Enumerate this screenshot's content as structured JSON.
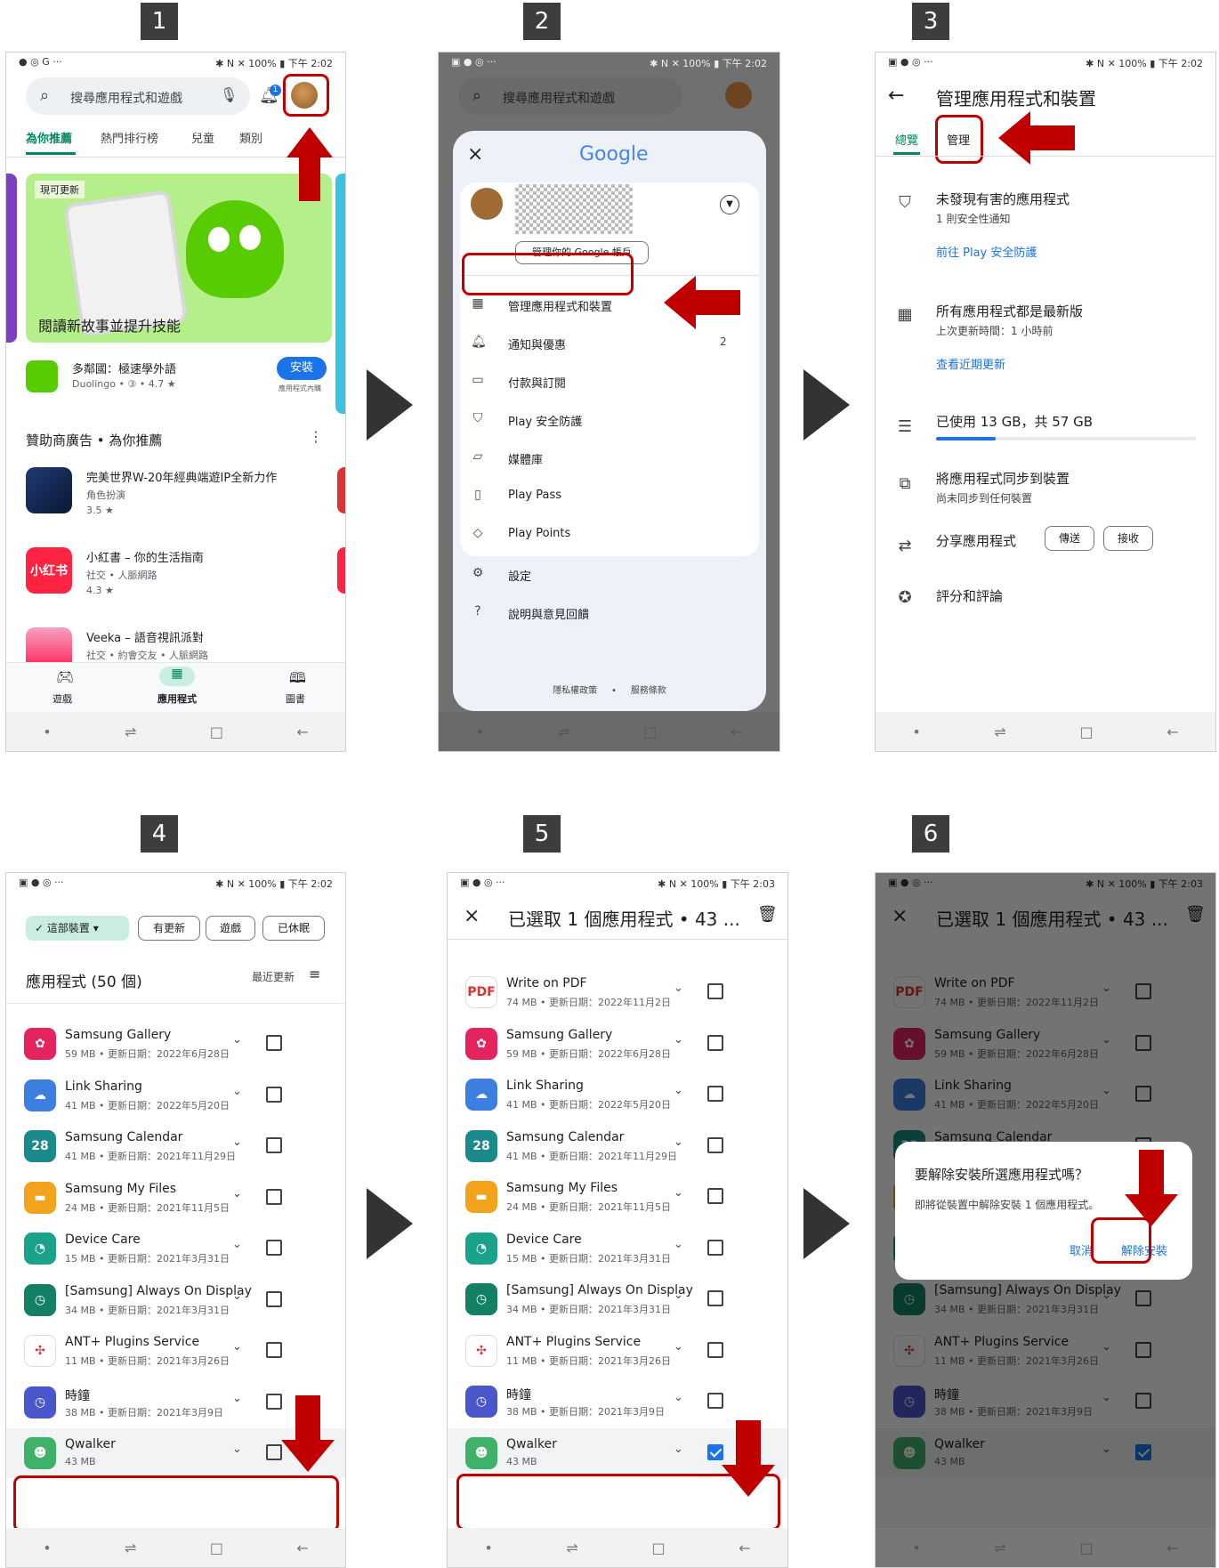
{
  "steps": [
    "1",
    "2",
    "3",
    "4",
    "5",
    "6"
  ],
  "status": {
    "left1": "● ◎ G ···",
    "left": "▣ ● ◎ ···",
    "right1": "✱ N ✕ 100% ▮ 下午 2:02",
    "right2": "✱ N ✕ 100% ▮ 下午 2:03"
  },
  "s1": {
    "search_placeholder": "搜尋應用程式和遊戲",
    "notif_count": "1",
    "tabs": [
      "為你推薦",
      "熱門排行榜",
      "兒童",
      "類別"
    ],
    "banner_tag": "現可更新",
    "banner_title": "閱讀新故事並提升技能",
    "feat_app": "多鄰國：極速學外語",
    "feat_meta": "Duolingo • ③ • 4.7 ★",
    "install": "安裝",
    "install_sub": "應用程式內購",
    "section": "贊助商廣告 • 為你推薦",
    "apps": [
      {
        "name": "完美世界W-20年經典端遊IP全新力作",
        "cat": "角色扮演",
        "rating": "3.5 ★"
      },
      {
        "name": "小紅書 – 你的生活指南",
        "cat": "社交 • 人脈網路",
        "rating": "4.3 ★"
      },
      {
        "name": "Veeka – 語音視訊派對",
        "cat": "社交 • 約會交友 • 人脈網路",
        "rating": ""
      }
    ],
    "xhs_logo": "小红书",
    "bottom": [
      "遊戲",
      "應用程式",
      "圖書"
    ]
  },
  "s2": {
    "search_placeholder": "搜尋應用程式和遊戲",
    "google": "Google",
    "manage_account": "管理你的 Google 帳戶",
    "items": [
      "管理應用程式和裝置",
      "通知與優惠",
      "付款與訂閱",
      "Play 安全防護",
      "媒體庫",
      "Play Pass",
      "Play Points",
      "設定",
      "說明與意見回饋"
    ],
    "notif_count": "2",
    "footer_privacy": "隱私權政策",
    "footer_dot": "•",
    "footer_terms": "服務條款"
  },
  "s3": {
    "title": "管理應用程式和裝置",
    "tab_overview": "總覽",
    "tab_manage": "管理",
    "rows": [
      {
        "title": "未發現有害的應用程式",
        "sub": "1 則安全性通知",
        "link": "前往 Play 安全防護"
      },
      {
        "title": "所有應用程式都是最新版",
        "sub": "上次更新時間：1 小時前",
        "link": "查看近期更新"
      },
      {
        "title": "已使用 13 GB，共 57 GB",
        "sub": "",
        "link": ""
      },
      {
        "title": "將應用程式同步到裝置",
        "sub": "尚未同步到任何裝置",
        "link": ""
      },
      {
        "title": "分享應用程式",
        "sub": "",
        "link": ""
      },
      {
        "title": "評分和評論",
        "sub": "",
        "link": ""
      }
    ],
    "send": "傳送",
    "receive": "接收",
    "storage_used_fraction": 0.23
  },
  "s4": {
    "chips": [
      "這部裝置",
      "有更新",
      "遊戲",
      "已休眠"
    ],
    "header": "應用程式 (50 個)",
    "sort": "最近更新"
  },
  "s5": {
    "title": "已選取 1 個應用程式 • 43 ..."
  },
  "s6": {
    "dialog_title": "要解除安裝所選應用程式嗎？",
    "dialog_body": "即將從裝置中解除安裝 1 個應用程式。",
    "cancel": "取消",
    "uninstall": "解除安裝"
  },
  "apps": [
    {
      "name": "Write on PDF",
      "meta": "74 MB • 更新日期：2022年11月2日",
      "color": "#ffffff",
      "glyph": "PDF"
    },
    {
      "name": "Samsung Gallery",
      "meta": "59 MB • 更新日期：2022年6月28日",
      "color": "#e3245f",
      "glyph": "✿"
    },
    {
      "name": "Link Sharing",
      "meta": "41 MB • 更新日期：2022年5月20日",
      "color": "#3d7fe0",
      "glyph": "☁"
    },
    {
      "name": "Samsung Calendar",
      "meta": "41 MB • 更新日期：2021年11月29日",
      "color": "#1b8a8a",
      "glyph": "28"
    },
    {
      "name": "Samsung My Files",
      "meta": "24 MB • 更新日期：2021年11月5日",
      "color": "#f2a21b",
      "glyph": "▬"
    },
    {
      "name": "Device Care",
      "meta": "15 MB • 更新日期：2021年3月31日",
      "color": "#1aa38a",
      "glyph": "◔"
    },
    {
      "name": "[Samsung] Always On Display",
      "meta": "34 MB • 更新日期：2021年3月31日",
      "color": "#138065",
      "glyph": "◷"
    },
    {
      "name": "ANT+ Plugins Service",
      "meta": "11 MB • 更新日期：2021年3月26日",
      "color": "#ffffff",
      "glyph": "✣"
    },
    {
      "name": "時鐘",
      "meta": "38 MB • 更新日期：2021年3月9日",
      "color": "#4a56c9",
      "glyph": "◷"
    },
    {
      "name": "Qwalker",
      "meta": "43 MB",
      "color": "#3fb26a",
      "glyph": "☻"
    }
  ],
  "colors": {
    "accent": "#1a73e8",
    "highlight": "#c00000",
    "play_green": "#01875f"
  }
}
